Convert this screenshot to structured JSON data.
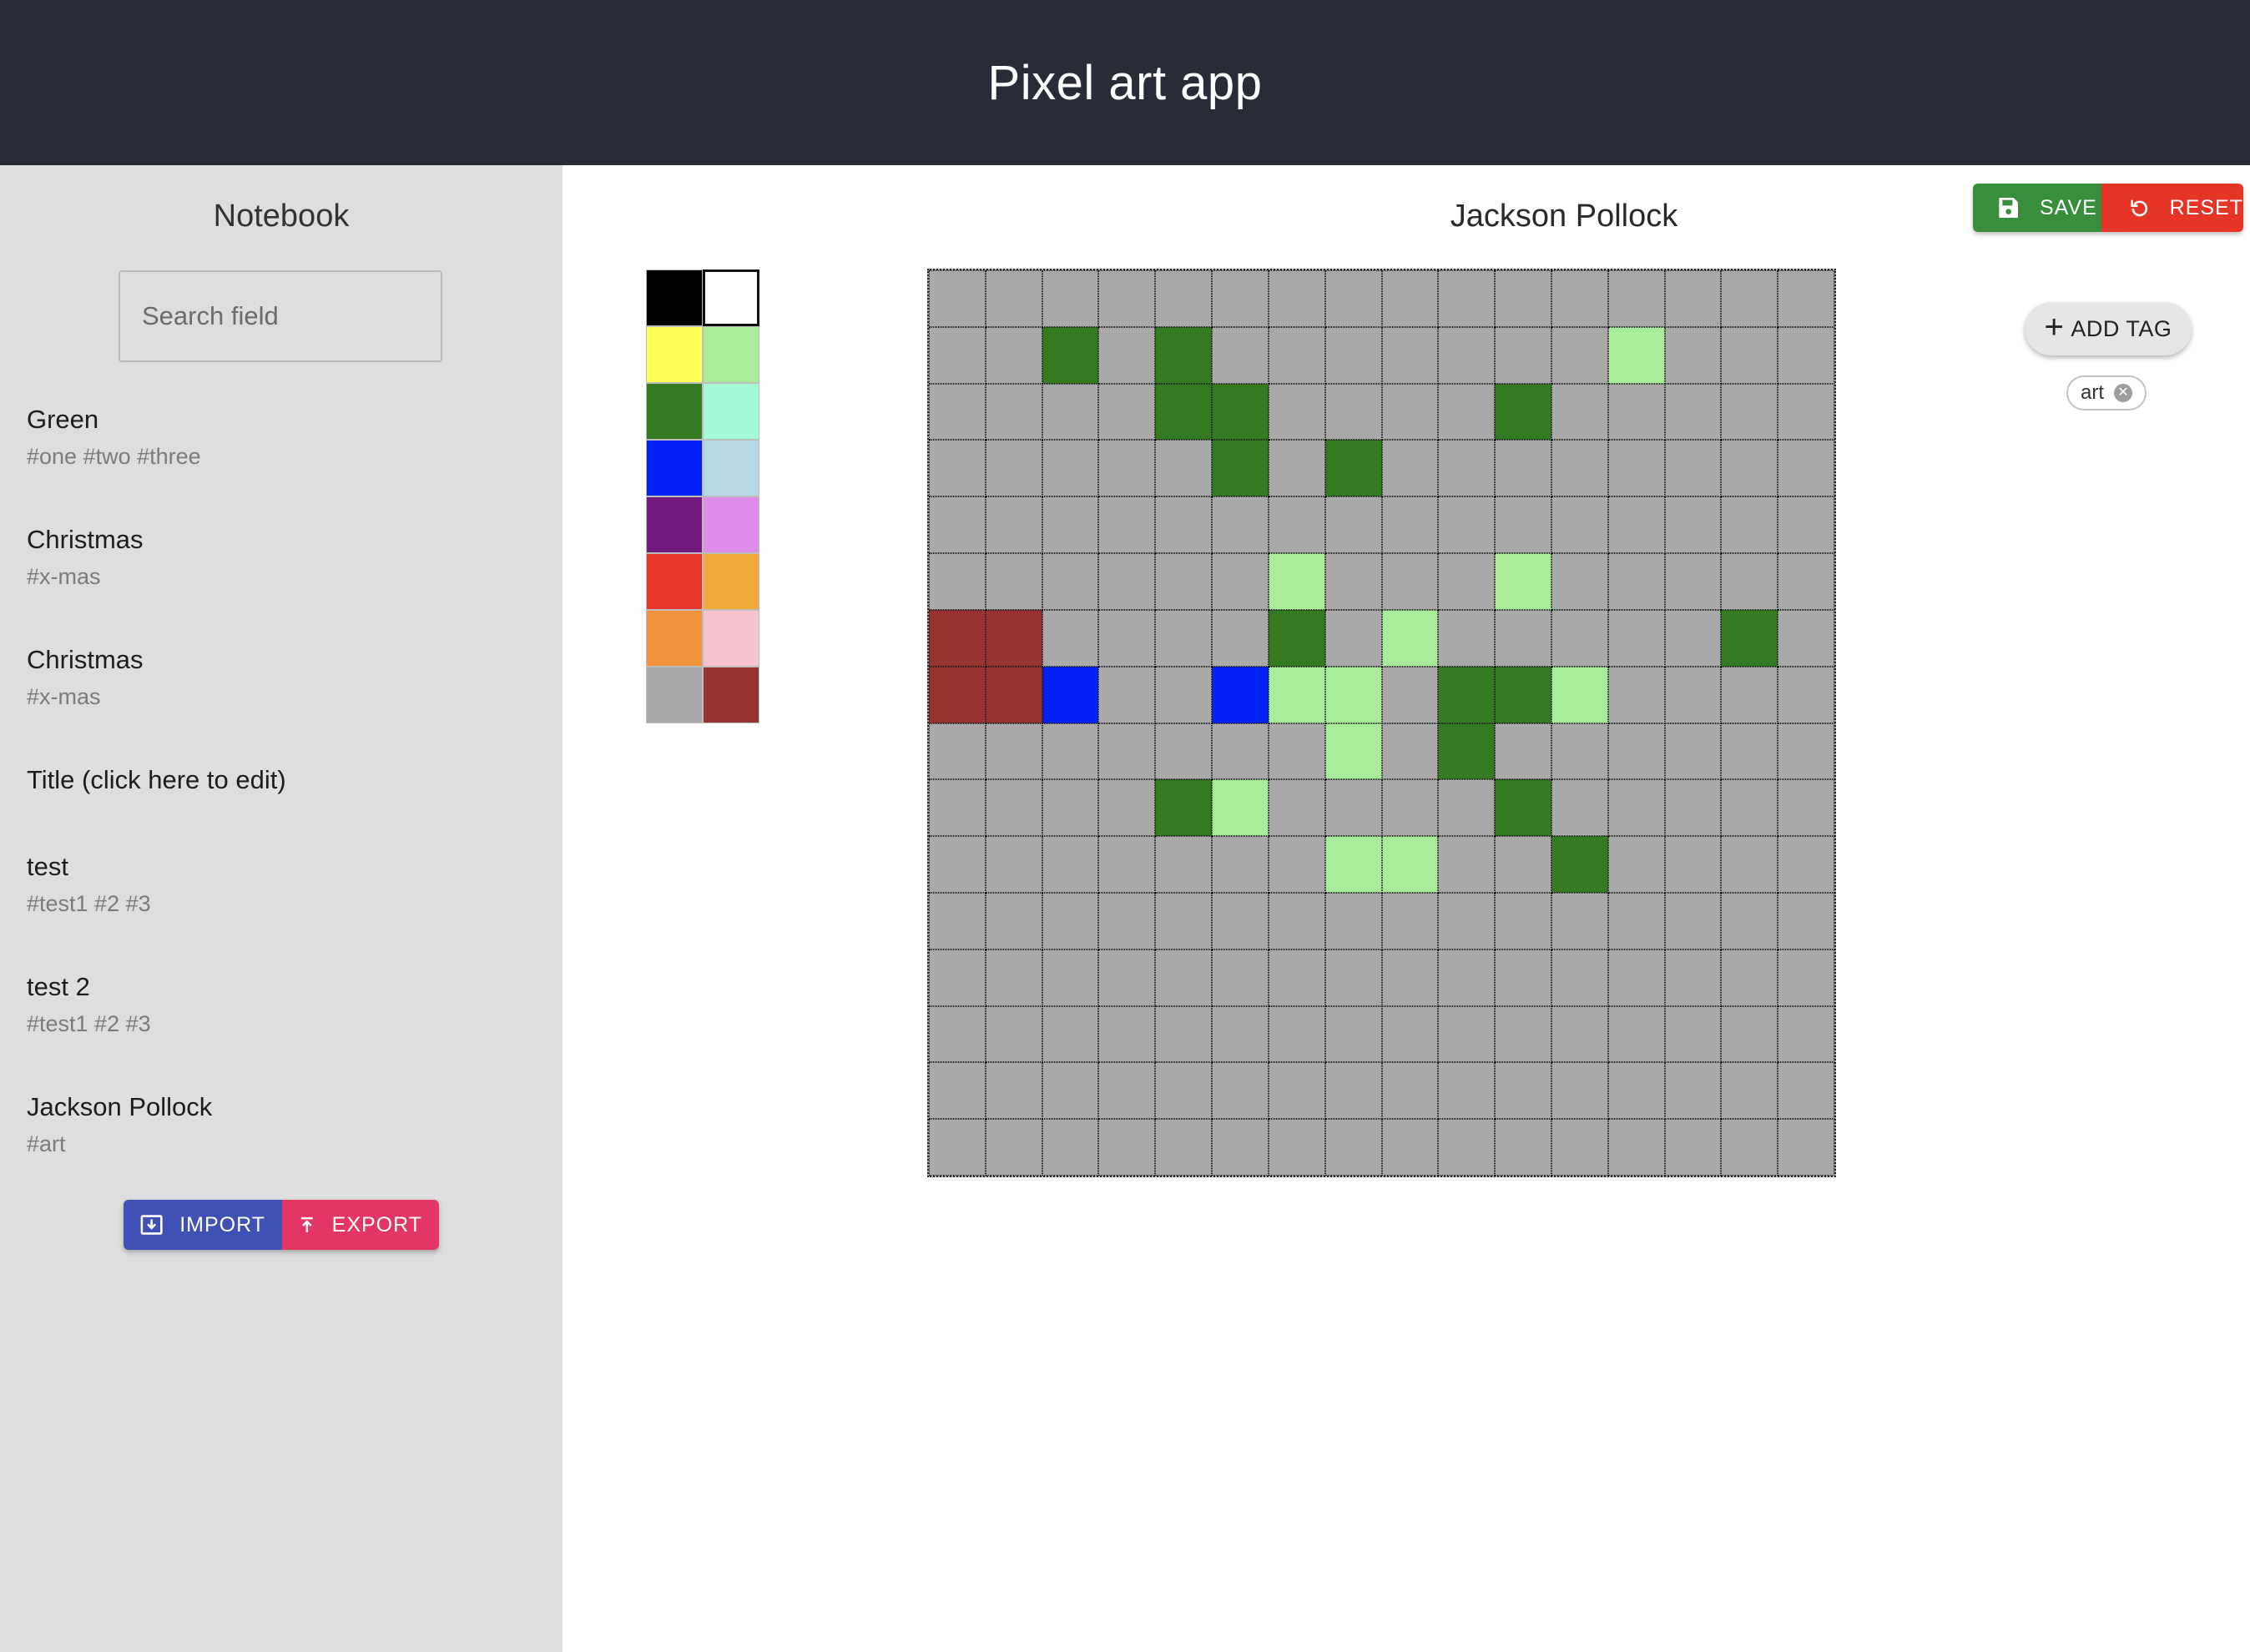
{
  "app": {
    "title": "Pixel art app"
  },
  "sidebar": {
    "title": "Notebook",
    "search_placeholder": "Search field",
    "notes": [
      {
        "title": "Green",
        "tags": "#one #two #three"
      },
      {
        "title": "Christmas",
        "tags": "#x-mas"
      },
      {
        "title": "Christmas",
        "tags": "#x-mas"
      },
      {
        "title": "Title (click here to edit)",
        "tags": ""
      },
      {
        "title": "test",
        "tags": "#test1 #2 #3"
      },
      {
        "title": "test 2",
        "tags": "#test1 #2 #3"
      },
      {
        "title": "Jackson Pollock",
        "tags": "#art"
      }
    ],
    "import_label": "IMPORT",
    "export_label": "EXPORT"
  },
  "editor": {
    "title": "Jackson Pollock",
    "save_label": "SAVE",
    "reset_label": "RESET",
    "add_tag_label": "ADD TAG",
    "tags": [
      "art"
    ],
    "palette": [
      "#000000",
      "#ffffff",
      "#ffff55",
      "#a8ec9a",
      "#347a20",
      "#a3fad7",
      "#0022f5",
      "#b7d8e3",
      "#731a7e",
      "#de8ee8",
      "#e8352a",
      "#f1a83d",
      "#f2943b",
      "#f4c3cd",
      "#a9a9a9",
      "#973330"
    ],
    "selected_color_index": 1,
    "grid_colors": {
      "g": "#a9a9a9",
      "d": "#347a20",
      "l": "#a8ec9a",
      "b": "#0022f5",
      "r": "#973330"
    },
    "grid": [
      "gggggggggggggggg",
      "ggdgdggggggglggg",
      "ggggddggggdggggg",
      "gggggdgdgggggggg",
      "gggggggggggggggg",
      "gggggglggglggggg",
      "rrggggdglgggggdg",
      "rrbggbllgddlgggg",
      "ggggggglgdgggggg",
      "ggggdlggggdggggg",
      "gggggggllggdgggg",
      "gggggggggggggggg",
      "gggggggggggggggg",
      "gggggggggggggggg",
      "gggggggggggggggg",
      "gggggggggggggggg"
    ]
  }
}
